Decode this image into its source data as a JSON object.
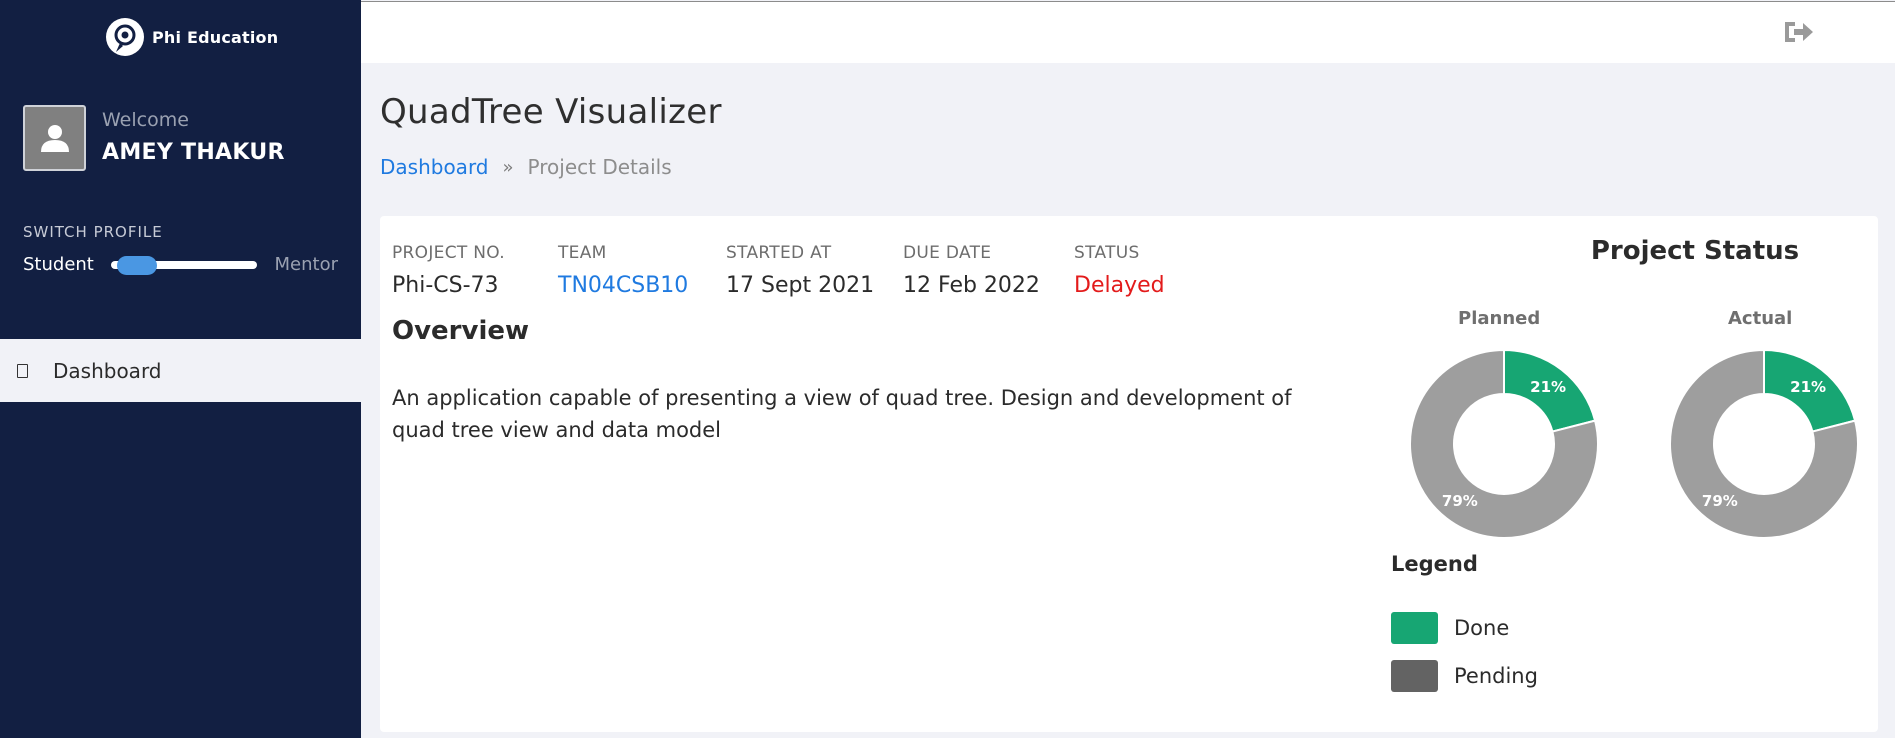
{
  "brand": {
    "name": "Phi Education"
  },
  "user": {
    "welcome": "Welcome",
    "name": "AMEY THAKUR"
  },
  "profile_switch": {
    "title": "SWITCH PROFILE",
    "left": "Student",
    "right": "Mentor"
  },
  "nav": {
    "items": [
      {
        "label": "Dashboard"
      }
    ]
  },
  "page": {
    "title": "QuadTree Visualizer"
  },
  "breadcrumb": {
    "home": "Dashboard",
    "separator": "»",
    "current": "Project Details"
  },
  "project": {
    "no_label": "PROJECT NO.",
    "no": "Phi-CS-73",
    "team_label": "TEAM",
    "team": "TN04CSB10",
    "started_label": "STARTED AT",
    "started": "17 Sept 2021",
    "due_label": "DUE DATE",
    "due": "12 Feb 2022",
    "status_label": "STATUS",
    "status": "Delayed"
  },
  "overview": {
    "title": "Overview",
    "text": "An application capable of presenting a view of quad tree. Design and development of quad tree view and data model"
  },
  "chart_data": [
    {
      "type": "pie",
      "title": "Planned",
      "categories": [
        "Done",
        "Pending"
      ],
      "values": [
        21,
        79
      ],
      "labels": [
        "21%",
        "79%"
      ]
    },
    {
      "type": "pie",
      "title": "Actual",
      "categories": [
        "Done",
        "Pending"
      ],
      "values": [
        21,
        79
      ],
      "labels": [
        "21%",
        "79%"
      ]
    }
  ],
  "status_panel": {
    "title": "Project Status"
  },
  "legend": {
    "title": "Legend",
    "items": [
      {
        "label": "Done",
        "color": "#17a673"
      },
      {
        "label": "Pending",
        "color": "#636363"
      }
    ]
  },
  "colors": {
    "sidebar": "#121f42",
    "done": "#17a673",
    "pending_slice": "#9e9e9e",
    "link": "#1f7ae0",
    "delayed": "#e31b1b"
  }
}
